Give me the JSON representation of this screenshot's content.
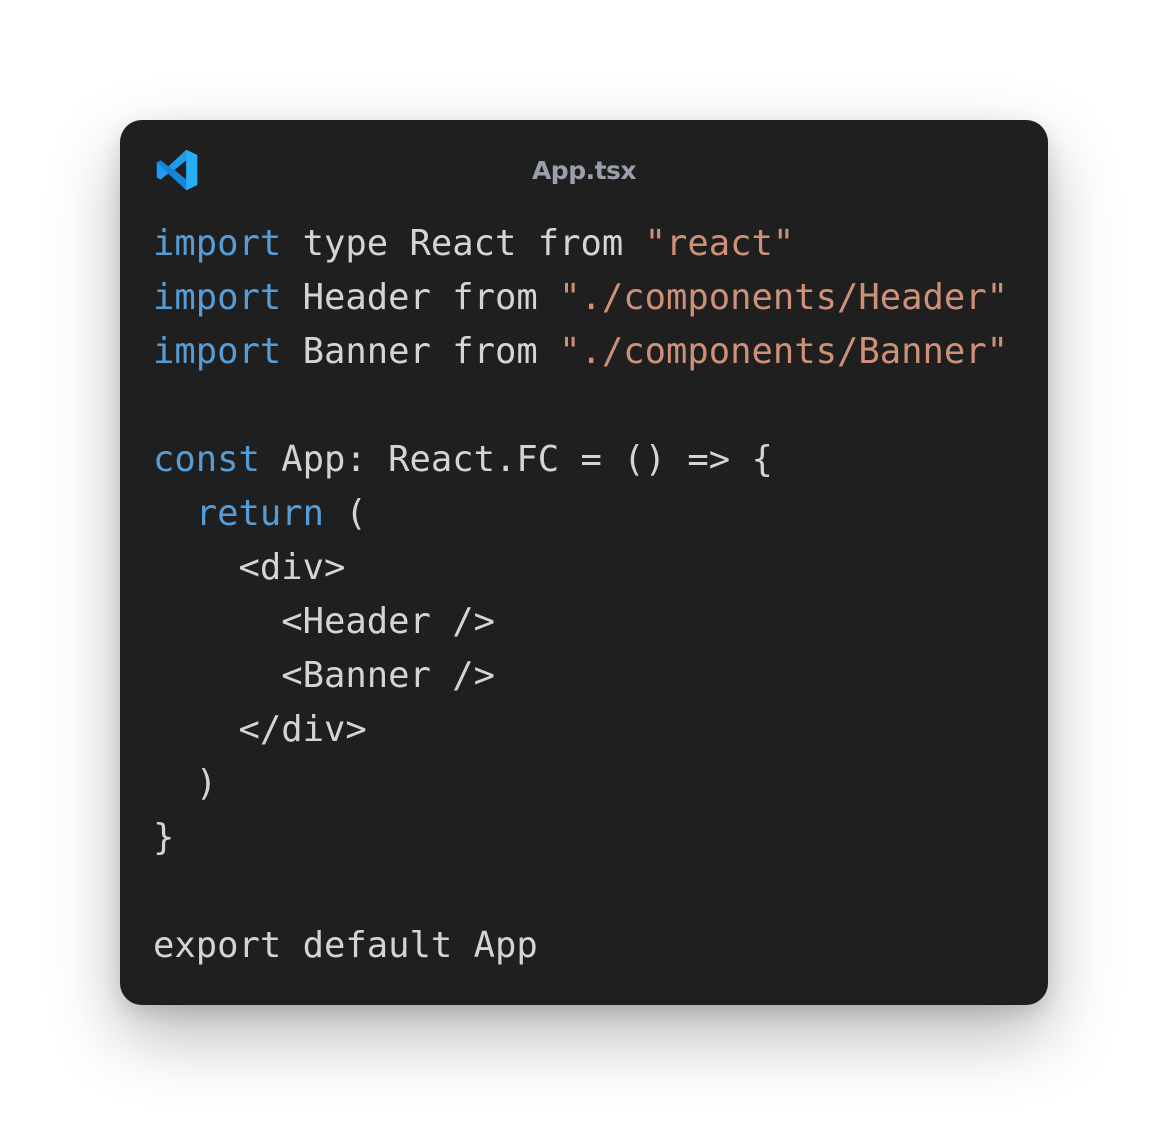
{
  "window": {
    "title": "App.tsx",
    "logo_icon": "vscode-logo-icon"
  },
  "colors": {
    "background": "#1f1f1f",
    "keyword": "#569cd6",
    "text": "#d4d4d4",
    "string": "#ce9178",
    "title": "#9aa0ab"
  },
  "code": {
    "lines": [
      [
        {
          "t": "import",
          "c": "kw"
        },
        {
          "t": " type React from ",
          "c": "txt"
        },
        {
          "t": "\"react\"",
          "c": "str"
        }
      ],
      [
        {
          "t": "import",
          "c": "kw"
        },
        {
          "t": " Header from ",
          "c": "txt"
        },
        {
          "t": "\"./components/Header\"",
          "c": "str"
        }
      ],
      [
        {
          "t": "import",
          "c": "kw"
        },
        {
          "t": " Banner from ",
          "c": "txt"
        },
        {
          "t": "\"./components/Banner\"",
          "c": "str"
        }
      ],
      [],
      [
        {
          "t": "const",
          "c": "kw"
        },
        {
          "t": " App: React.FC = () => {",
          "c": "txt"
        }
      ],
      [
        {
          "t": "  ",
          "c": "txt"
        },
        {
          "t": "return",
          "c": "kw"
        },
        {
          "t": " (",
          "c": "txt"
        }
      ],
      [
        {
          "t": "    <div>",
          "c": "txt"
        }
      ],
      [
        {
          "t": "      <Header />",
          "c": "txt"
        }
      ],
      [
        {
          "t": "      <Banner />",
          "c": "txt"
        }
      ],
      [
        {
          "t": "    </div>",
          "c": "txt"
        }
      ],
      [
        {
          "t": "  )",
          "c": "txt"
        }
      ],
      [
        {
          "t": "}",
          "c": "txt"
        }
      ],
      [],
      [
        {
          "t": "export default App",
          "c": "txt"
        }
      ]
    ]
  }
}
